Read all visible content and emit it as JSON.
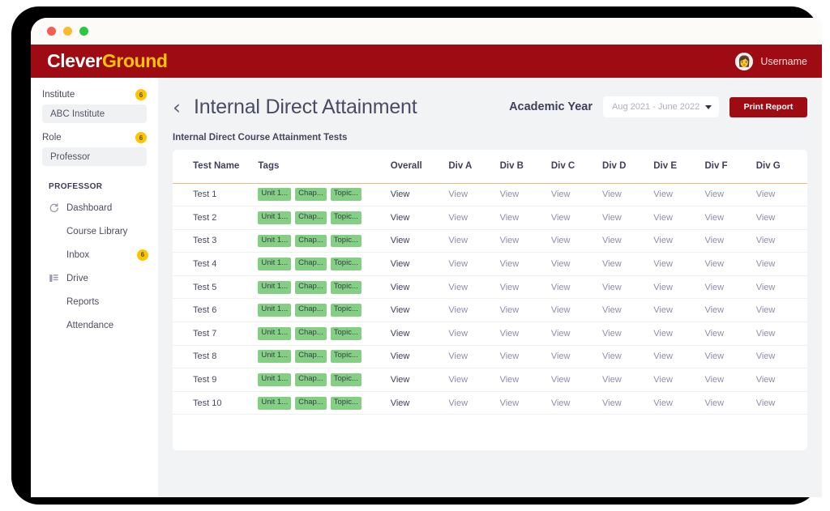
{
  "window": {
    "dots": [
      "close-red",
      "minimize-yellow",
      "maximize-green"
    ]
  },
  "brand": {
    "logo_part1": "Clever",
    "logo_part2": "Ground",
    "logo_color_1": "#ffffff",
    "logo_color_2": "#ffc400",
    "bar_color": "#9e0b12",
    "avatar_glyph": "👩",
    "username": "Username"
  },
  "sidebar": {
    "institute": {
      "label": "Institute",
      "badge": "6",
      "value": "ABC Institute"
    },
    "role": {
      "label": "Role",
      "badge": "6",
      "value": "Professor"
    },
    "section_title": "PROFESSOR",
    "items": [
      {
        "label": "Dashboard",
        "icon": "dashboard-icon",
        "badge": ""
      },
      {
        "label": "Course Library",
        "icon": "",
        "badge": ""
      },
      {
        "label": "Inbox",
        "icon": "",
        "badge": "6"
      },
      {
        "label": "Drive",
        "icon": "drive-icon",
        "badge": ""
      },
      {
        "label": "Reports",
        "icon": "",
        "badge": ""
      },
      {
        "label": "Attendance",
        "icon": "",
        "badge": ""
      }
    ]
  },
  "header": {
    "back_icon": "‹",
    "title": "Internal Direct Attainment",
    "academic_year_label": "Academic Year",
    "academic_year_value": "Aug 2021 - June 2022",
    "print_label": "Print Report"
  },
  "table": {
    "caption": "Internal Direct Course Attainment Tests",
    "columns": [
      "Test Name",
      "Tags",
      "Overall",
      "Div A",
      "Div B",
      "Div C",
      "Div D",
      "Div E",
      "Div F",
      "Div G"
    ],
    "view_label": "View",
    "accent_color": "#f0b97e",
    "chip_color": "#85cf85",
    "rows": [
      {
        "name": "Test 1",
        "tags": [
          "Unit 1...",
          "Chap...",
          "Topic..."
        ],
        "overall": "View",
        "divs": [
          "View",
          "View",
          "View",
          "View",
          "View",
          "View",
          "View"
        ]
      },
      {
        "name": "Test 2",
        "tags": [
          "Unit 1...",
          "Chap...",
          "Topic..."
        ],
        "overall": "View",
        "divs": [
          "View",
          "View",
          "View",
          "View",
          "View",
          "View",
          "View"
        ]
      },
      {
        "name": "Test 3",
        "tags": [
          "Unit 1...",
          "Chap...",
          "Topic..."
        ],
        "overall": "View",
        "divs": [
          "View",
          "View",
          "View",
          "View",
          "View",
          "View",
          "View"
        ]
      },
      {
        "name": "Test 4",
        "tags": [
          "Unit 1...",
          "Chap...",
          "Topic..."
        ],
        "overall": "View",
        "divs": [
          "View",
          "View",
          "View",
          "View",
          "View",
          "View",
          "View"
        ]
      },
      {
        "name": "Test 5",
        "tags": [
          "Unit 1...",
          "Chap...",
          "Topic..."
        ],
        "overall": "View",
        "divs": [
          "View",
          "View",
          "View",
          "View",
          "View",
          "View",
          "View"
        ]
      },
      {
        "name": "Test 6",
        "tags": [
          "Unit 1...",
          "Chap...",
          "Topic..."
        ],
        "overall": "View",
        "divs": [
          "View",
          "View",
          "View",
          "View",
          "View",
          "View",
          "View"
        ]
      },
      {
        "name": "Test 7",
        "tags": [
          "Unit 1...",
          "Chap...",
          "Topic..."
        ],
        "overall": "View",
        "divs": [
          "View",
          "View",
          "View",
          "View",
          "View",
          "View",
          "View"
        ]
      },
      {
        "name": "Test 8",
        "tags": [
          "Unit 1...",
          "Chap...",
          "Topic..."
        ],
        "overall": "View",
        "divs": [
          "View",
          "View",
          "View",
          "View",
          "View",
          "View",
          "View"
        ]
      },
      {
        "name": "Test 9",
        "tags": [
          "Unit 1...",
          "Chap...",
          "Topic..."
        ],
        "overall": "View",
        "divs": [
          "View",
          "View",
          "View",
          "View",
          "View",
          "View",
          "View"
        ]
      },
      {
        "name": "Test 10",
        "tags": [
          "Unit 1...",
          "Chap...",
          "Topic..."
        ],
        "overall": "View",
        "divs": [
          "View",
          "View",
          "View",
          "View",
          "View",
          "View",
          "View"
        ]
      }
    ]
  }
}
